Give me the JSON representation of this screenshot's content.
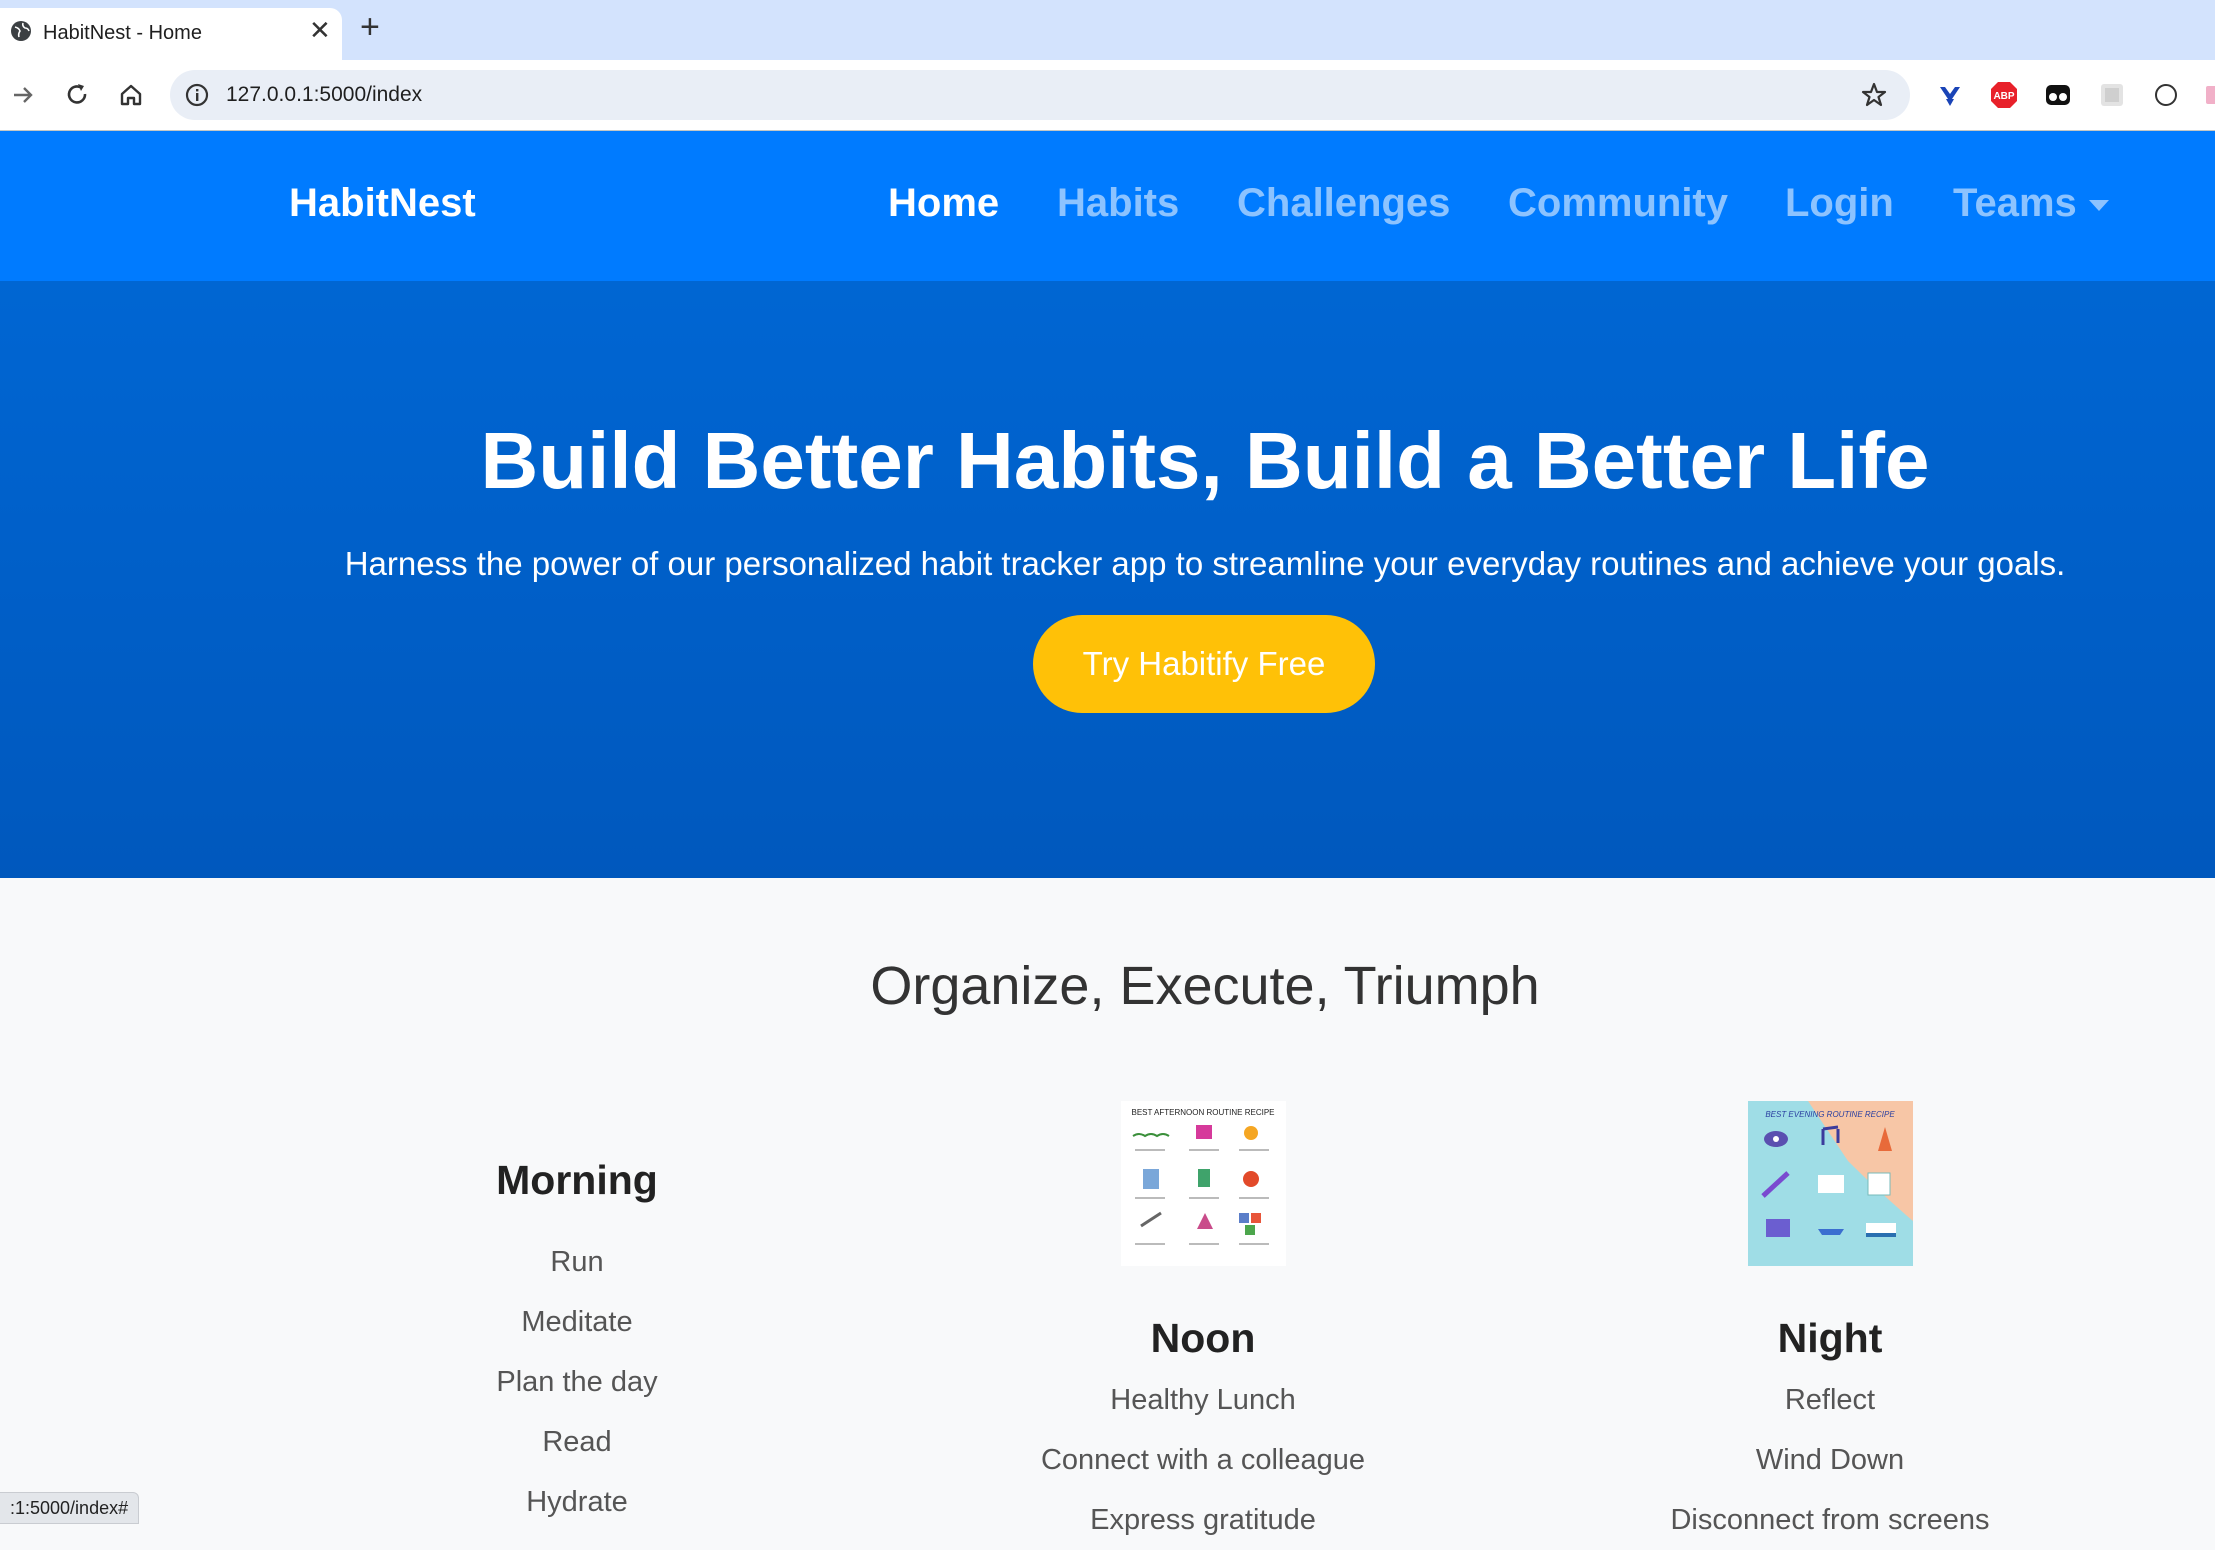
{
  "browser": {
    "tab_title": "HabitNest - Home",
    "url": "127.0.0.1:5000/index",
    "extensions": [
      "yoroi-icon",
      "adblock-plus-icon",
      "ghost-extension-icon",
      "puzzle-extension-icon",
      "circle-extension-icon"
    ]
  },
  "nav": {
    "brand": "HabitNest",
    "links": [
      "Home",
      "Habits",
      "Challenges",
      "Community",
      "Login",
      "Teams"
    ],
    "active": "Home"
  },
  "hero": {
    "title": "Build Better Habits, Build a Better Life",
    "subtitle": "Harness the power of our personalized habit tracker app to streamline your everyday routines and achieve your goals.",
    "cta": "Try Habitify Free"
  },
  "routines": {
    "title": "Organize, Execute, Triumph",
    "columns": [
      {
        "title": "Morning",
        "items": [
          "Run",
          "Meditate",
          "Plan the day",
          "Read",
          "Hydrate"
        ]
      },
      {
        "title": "Noon",
        "image_text": "BEST AFTERNOON ROUTINE RECIPE",
        "items": [
          "Healthy Lunch",
          "Connect with a colleague",
          "Express gratitude"
        ]
      },
      {
        "title": "Night",
        "image_text": "BEST EVENING ROUTINE RECIPE",
        "items": [
          "Reflect",
          "Wind Down",
          "Disconnect from screens"
        ]
      }
    ]
  },
  "status_bar": ":1:5000/index#",
  "colors": {
    "navbar": "#007bff",
    "hero": "#0062cc",
    "cta": "#ffc107",
    "page_bg": "#f8f9fa"
  }
}
